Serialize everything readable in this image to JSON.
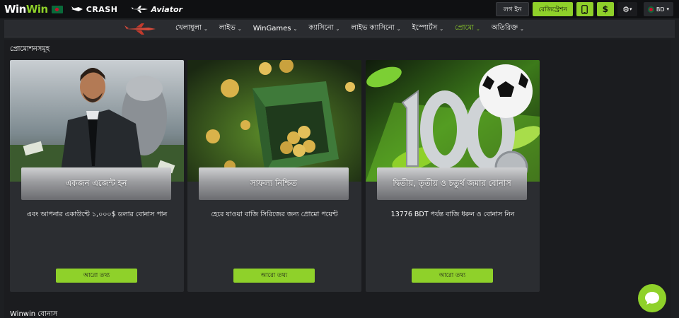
{
  "header": {
    "logo_part1": "Win",
    "logo_part2": "Win",
    "crash_label": "CRASH",
    "aviator_label": "Aviator",
    "login_label": "লগ ইন",
    "register_label": "রেজিস্ট্রেশন",
    "deposit_symbol": "$",
    "language_label": "BD"
  },
  "nav": {
    "items": [
      {
        "label": "খেলাধুলা",
        "has_dropdown": true
      },
      {
        "label": "লাইভ",
        "has_dropdown": true
      },
      {
        "label": "WinGames",
        "has_dropdown": true
      },
      {
        "label": "ক্যাসিনো",
        "has_dropdown": true
      },
      {
        "label": "লাইভ ক্যাসিনো",
        "has_dropdown": true
      },
      {
        "label": "ইস্পোর্টস",
        "has_dropdown": true
      },
      {
        "label": "প্রোমো",
        "has_dropdown": true,
        "active": true
      },
      {
        "label": "অতিরিক্ত",
        "has_dropdown": true
      }
    ]
  },
  "promotions": {
    "section_title": "প্রোমোশনসমূহ",
    "cards": [
      {
        "title": "একজন এজেন্ট হন",
        "description": "এবং আপনার একাউন্টে ১,০০০$ ডলার বোনাস পান",
        "button_label": "আরো তথ্য"
      },
      {
        "title": "সাফল্য নিশ্চিত",
        "description": "হেরে যাওয়া বাজি সিরিজের জন্য প্রোমো পয়েন্ট",
        "button_label": "আরো তথ্য"
      },
      {
        "title": "দ্বিতীয়, তৃতীয় ও চতুর্থ জমার বোনাস",
        "description": "13776 BDT পর্যন্ত বাজি ধরুন ও বোনাস নিন",
        "button_label": "আরো তথ্য"
      }
    ]
  },
  "bonus_section": {
    "title": "Winwin বোনাস"
  },
  "colors": {
    "accent": "#8fd12a",
    "background": "#1d1f22",
    "card": "#2b2d31"
  }
}
